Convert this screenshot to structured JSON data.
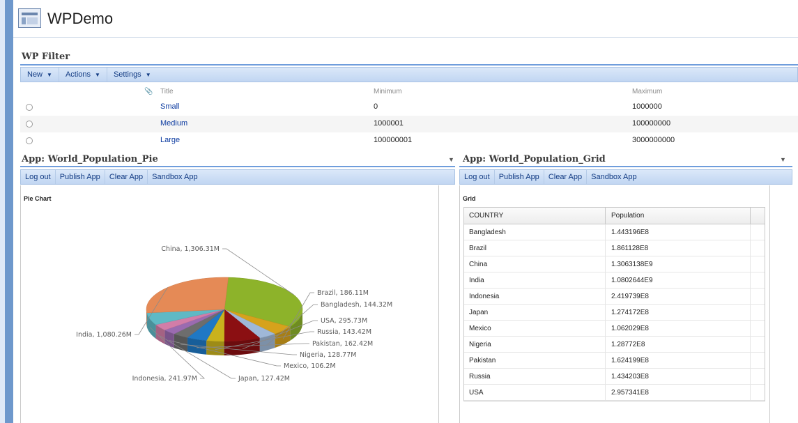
{
  "app": {
    "title": "WPDemo"
  },
  "wp_filter": {
    "title": "WP Filter",
    "toolbar": [
      "New",
      "Actions",
      "Settings"
    ],
    "columns": {
      "title": "Title",
      "minimum": "Minimum",
      "maximum": "Maximum"
    },
    "rows": [
      {
        "title": "Small",
        "minimum": "0",
        "maximum": "1000000"
      },
      {
        "title": "Medium",
        "minimum": "1000001",
        "maximum": "100000000"
      },
      {
        "title": "Large",
        "minimum": "100000001",
        "maximum": "3000000000"
      }
    ]
  },
  "pie_app": {
    "title": "App: World_Population_Pie",
    "toolbar": [
      "Log out",
      "Publish App",
      "Clear App",
      "Sandbox App"
    ],
    "panel_title": "Pie Chart"
  },
  "grid_app": {
    "title": "App: World_Population_Grid",
    "toolbar": [
      "Log out",
      "Publish App",
      "Clear App",
      "Sandbox App"
    ],
    "panel_title": "Grid",
    "columns": [
      "COUNTRY",
      "Population"
    ],
    "rows": [
      [
        "Bangladesh",
        "1.443196E8"
      ],
      [
        "Brazil",
        "1.861128E8"
      ],
      [
        "China",
        "1.3063138E9"
      ],
      [
        "India",
        "1.0802644E9"
      ],
      [
        "Indonesia",
        "2.419739E8"
      ],
      [
        "Japan",
        "1.274172E8"
      ],
      [
        "Mexico",
        "1.062029E8"
      ],
      [
        "Nigeria",
        "1.28772E8"
      ],
      [
        "Pakistan",
        "1.624199E8"
      ],
      [
        "Russia",
        "1.434203E8"
      ],
      [
        "USA",
        "2.957341E8"
      ]
    ]
  },
  "chart_data": {
    "type": "pie",
    "categories": [
      "China",
      "Brazil",
      "Bangladesh",
      "USA",
      "Russia",
      "Pakistan",
      "Nigeria",
      "Mexico",
      "Japan",
      "Indonesia",
      "India"
    ],
    "values": [
      1306.31,
      186.11,
      144.32,
      295.73,
      143.42,
      162.42,
      128.77,
      106.2,
      127.42,
      241.97,
      1080.26
    ],
    "labels": [
      "China, 1,306.31M",
      "Brazil, 186.11M",
      "Bangladesh, 144.32M",
      "USA, 295.73M",
      "Russia, 143.42M",
      "Pakistan, 162.42M",
      "Nigeria, 128.77M",
      "Mexico, 106.2M",
      "Japan, 127.42M",
      "Indonesia, 241.97M",
      "India, 1,080.26M"
    ],
    "colors": [
      "#8db32a",
      "#d6a21c",
      "#9fb8d8",
      "#8b0f12",
      "#c9b21d",
      "#1f78c4",
      "#6d6d6d",
      "#9a6bb0",
      "#d27da8",
      "#5fb9c5",
      "#e58a56"
    ],
    "style": "3d"
  }
}
